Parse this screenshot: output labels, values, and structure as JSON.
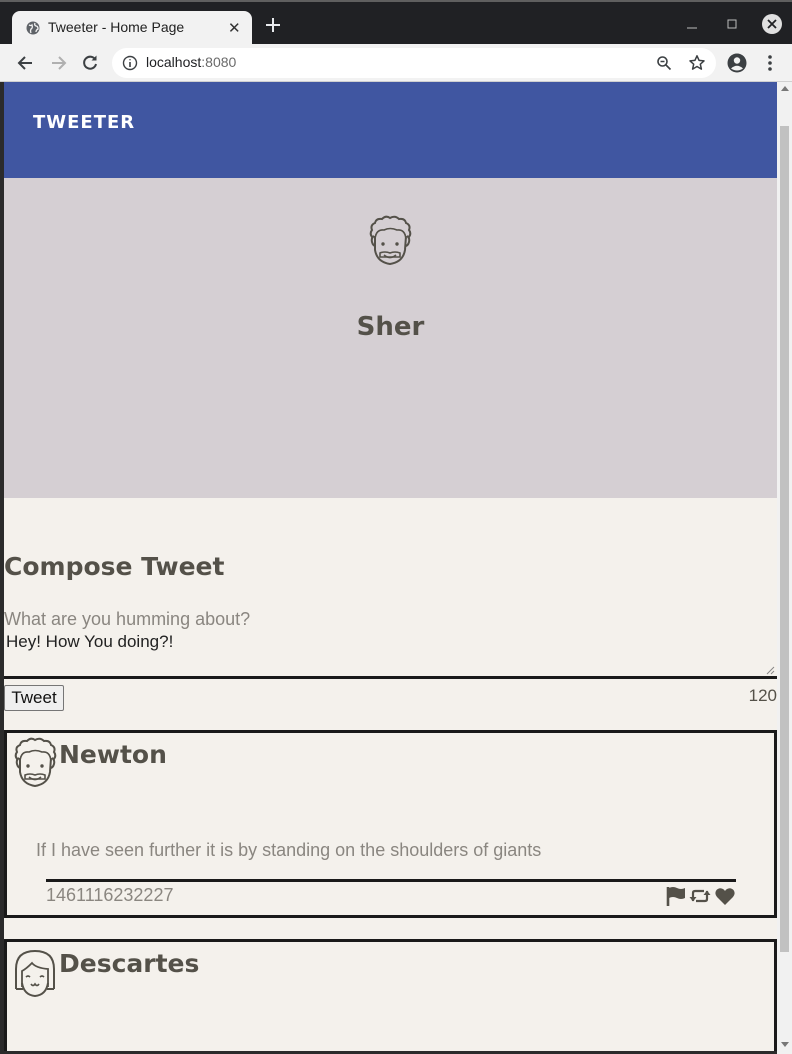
{
  "browser": {
    "tab_title": "Tweeter - Home Page",
    "url_host": "localhost",
    "url_port": ":8080"
  },
  "app": {
    "brand": "TWEETER",
    "colors": {
      "navbar": "#4056a1",
      "profile_bg": "#d5cfd3",
      "page_bg": "#f4f1ec",
      "text": "#545149"
    }
  },
  "profile": {
    "name": "Sher",
    "avatar": "smiling-face-curly-hair-icon"
  },
  "compose": {
    "title": "Compose Tweet",
    "label": "What are you humming about?",
    "value": "Hey! How You doing?!",
    "button": "Tweet",
    "counter": "120"
  },
  "tweets": [
    {
      "name": "Newton",
      "avatar": "curly-hair-face-icon",
      "content": "If I have seen further it is by standing on the shoulders of giants",
      "timestamp": "1461116232227",
      "actions": [
        "flag-icon",
        "retweet-icon",
        "heart-icon"
      ]
    },
    {
      "name": "Descartes",
      "avatar": "bob-hair-face-icon"
    }
  ]
}
